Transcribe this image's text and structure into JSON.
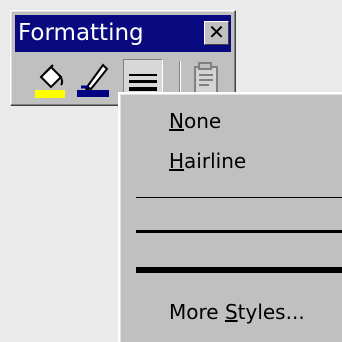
{
  "toolbar": {
    "title": "Formatting",
    "close_glyph": "✕",
    "buttons": [
      {
        "name": "fill-color",
        "icon": "paint-bucket-icon",
        "swatch_color": "#ffff00"
      },
      {
        "name": "line-color",
        "icon": "pen-icon",
        "swatch_color": "#000080"
      },
      {
        "name": "line-style",
        "icon": "line-style-icon",
        "pressed": true
      },
      {
        "name": "format-object",
        "icon": "format-object-icon",
        "enabled": false
      }
    ]
  },
  "menu": {
    "none": {
      "mnemonic": "N",
      "rest": "one"
    },
    "hairline": {
      "mnemonic": "H",
      "rest": "airline"
    },
    "line_styles": [
      "hairline",
      "thin",
      "medium",
      "thick"
    ],
    "more_styles": {
      "before": "More ",
      "mnemonic": "S",
      "after": "tyles..."
    }
  },
  "colors": {
    "titlebar": "#0a0a80",
    "face": "#c0c0c0",
    "desktop": "#eaeaea"
  }
}
